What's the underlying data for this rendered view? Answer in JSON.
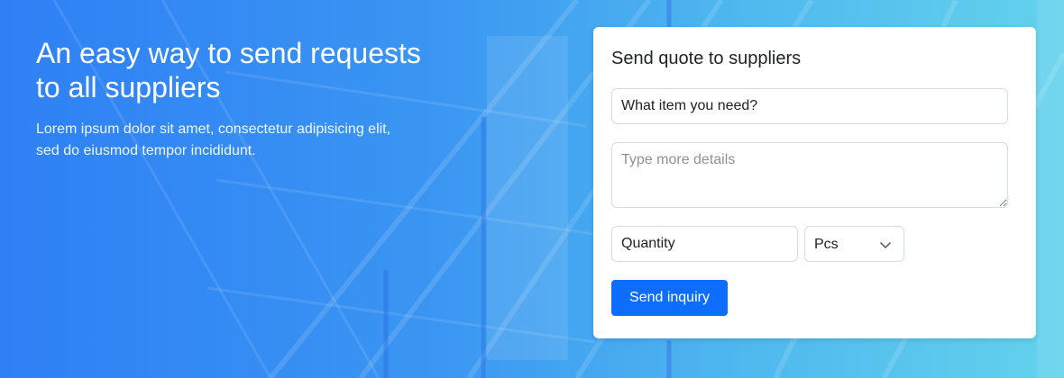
{
  "hero": {
    "headline": "An easy way to send requests to all suppliers",
    "subtext": "Lorem ipsum dolor sit amet, consectetur adipisicing elit, sed do eiusmod tempor incididunt."
  },
  "form": {
    "title": "Send quote to suppliers",
    "item_placeholder": "What item you need?",
    "details_placeholder": "Type more details",
    "quantity_placeholder": "Quantity",
    "unit_selected": "Pcs",
    "submit_label": "Send inquiry"
  },
  "colors": {
    "primary": "#0d6efd",
    "banner_start": "#2f80f5",
    "banner_end": "#63d2ec"
  },
  "icons": {
    "select_chevron": "chevron-down-icon"
  }
}
